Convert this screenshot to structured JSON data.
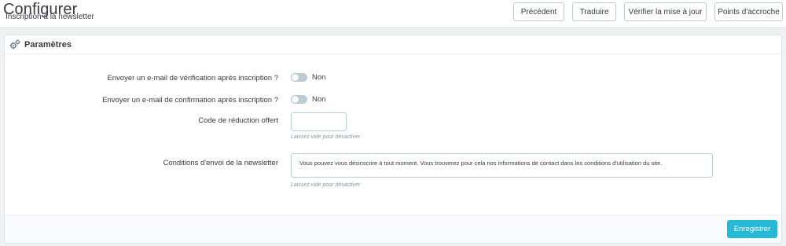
{
  "header": {
    "title": "Configurer",
    "breadcrumb": "Inscription à la newsletter",
    "toolbar": {
      "previous_label": "Précédent",
      "translate_label": "Traduire",
      "check_update_label": "Vérifier la mise à jour",
      "hooks_label": "Points d'accroche"
    }
  },
  "panel": {
    "title": "Paramètres",
    "icon": "gears-icon",
    "fields": {
      "verification_email": {
        "label": "Envoyer un e-mail de vérification après inscription ?",
        "state_label": "Non",
        "enabled": false
      },
      "confirmation_email": {
        "label": "Envoyer un e-mail de confirmation après inscription ?",
        "state_label": "Non",
        "enabled": false
      },
      "voucher_code": {
        "label": "Code de réduction offert",
        "value": "",
        "help": "Laissez vide pour désactiver"
      },
      "conditions": {
        "label": "Conditions d'envoi de la newsletter",
        "value": "Vous pouvez vous désinscrire à tout moment. Vous trouverez pour cela nos informations de contact dans les conditions d'utilisation du site.",
        "help": "Laissez vide pour désactiver"
      }
    },
    "save_label": "Enregistrer"
  },
  "colors": {
    "accent": "#25b9d7",
    "border": "#bbcdd2",
    "background": "#eff1f2"
  }
}
